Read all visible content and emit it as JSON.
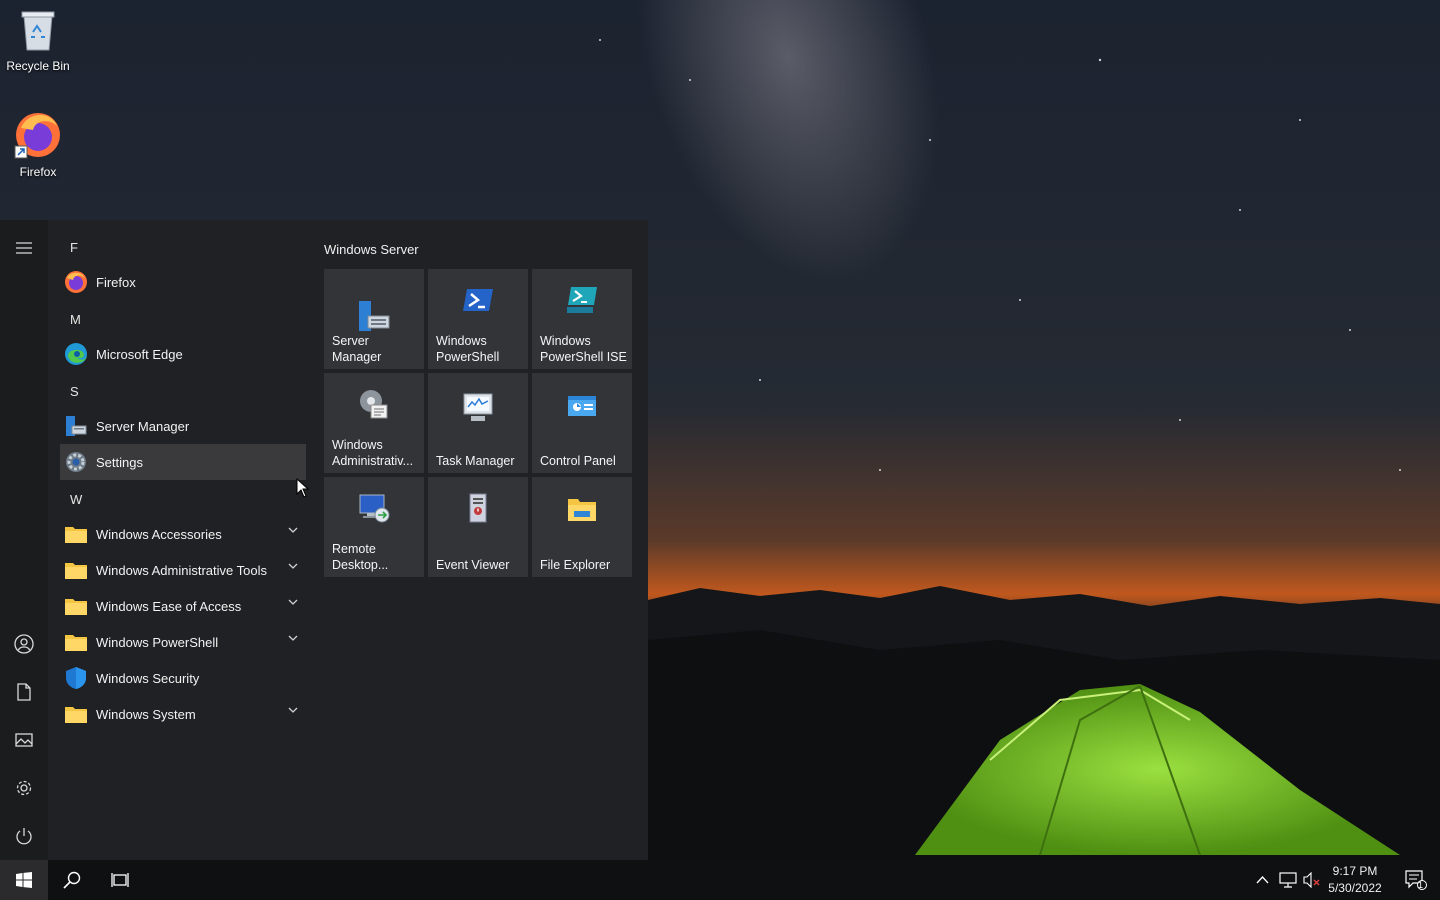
{
  "desktop": {
    "icons": [
      {
        "label": "Recycle Bin",
        "icon": "recycle-bin-icon"
      },
      {
        "label": "Firefox",
        "icon": "firefox-icon"
      }
    ]
  },
  "start_menu": {
    "app_list": {
      "sections": [
        {
          "letter": "F",
          "items": [
            {
              "label": "Firefox",
              "icon": "firefox-icon"
            }
          ]
        },
        {
          "letter": "M",
          "items": [
            {
              "label": "Microsoft Edge",
              "icon": "edge-icon"
            }
          ]
        },
        {
          "letter": "S",
          "items": [
            {
              "label": "Server Manager",
              "icon": "server-manager-icon"
            },
            {
              "label": "Settings",
              "icon": "gear-icon",
              "hovered": true
            }
          ]
        },
        {
          "letter": "W",
          "items": [
            {
              "label": "Windows Accessories",
              "icon": "folder-icon",
              "expandable": true
            },
            {
              "label": "Windows Administrative Tools",
              "icon": "folder-icon",
              "expandable": true
            },
            {
              "label": "Windows Ease of Access",
              "icon": "folder-icon",
              "expandable": true
            },
            {
              "label": "Windows PowerShell",
              "icon": "folder-icon",
              "expandable": true
            },
            {
              "label": "Windows Security",
              "icon": "shield-icon",
              "expandable": false
            },
            {
              "label": "Windows System",
              "icon": "folder-icon",
              "expandable": true
            }
          ]
        }
      ]
    },
    "tiles_group": {
      "title": "Windows Server",
      "tiles": [
        {
          "label": "Server Manager",
          "icon": "server-manager-icon"
        },
        {
          "label": "Windows PowerShell",
          "icon": "powershell-icon"
        },
        {
          "label": "Windows PowerShell ISE",
          "icon": "powershell-ise-icon"
        },
        {
          "label": "Windows Administrativ...",
          "icon": "admin-tools-icon"
        },
        {
          "label": "Task Manager",
          "icon": "task-manager-icon"
        },
        {
          "label": "Control Panel",
          "icon": "control-panel-icon"
        },
        {
          "label": "Remote Desktop...",
          "icon": "remote-desktop-icon"
        },
        {
          "label": "Event Viewer",
          "icon": "event-viewer-icon"
        },
        {
          "label": "File Explorer",
          "icon": "file-explorer-icon"
        }
      ]
    },
    "rail": [
      "hamburger-icon",
      "user-icon",
      "documents-icon",
      "pictures-icon",
      "gear-icon",
      "power-icon"
    ]
  },
  "taskbar": {
    "buttons": [
      "windows-logo-icon",
      "search-icon",
      "task-view-icon"
    ],
    "tray": [
      "chevron-up-icon",
      "network-icon",
      "volume-muted-icon",
      "notifications-icon"
    ],
    "notification_count": "1",
    "clock": {
      "time": "9:17 PM",
      "date": "5/30/2022"
    }
  },
  "colors": {
    "accent": "#0078d7",
    "start_bg": "#202124",
    "tile_bg": "#333438",
    "taskbar_bg": "#0f1012"
  }
}
